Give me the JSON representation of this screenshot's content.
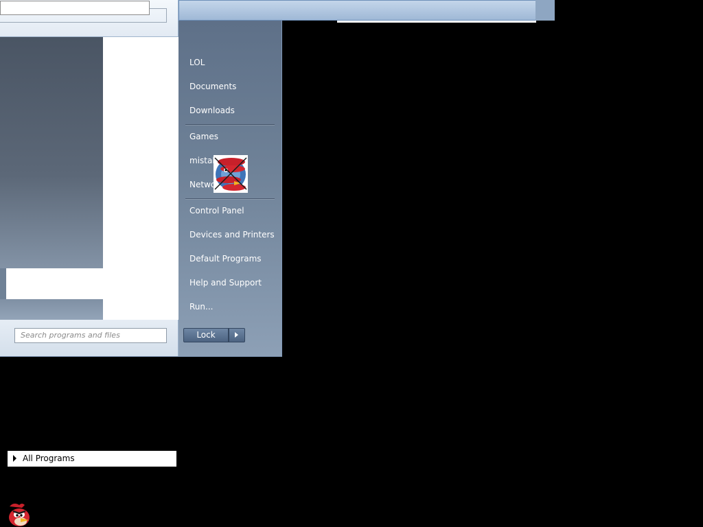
{
  "search": {
    "placeholder": "Search programs and files"
  },
  "right_menu": {
    "items": [
      {
        "label": "LOL"
      },
      {
        "label": "Documents"
      },
      {
        "label": "Downloads"
      },
      {
        "label": "Games"
      },
      {
        "label": "mistak"
      },
      {
        "label": "Netwo"
      },
      {
        "label": "Control Panel"
      },
      {
        "label": "Devices and Printers"
      },
      {
        "label": "Default Programs"
      },
      {
        "label": "Help and Support"
      },
      {
        "label": "Run..."
      }
    ]
  },
  "shutdown": {
    "label": "Lock"
  },
  "all_programs": {
    "label": "All Programs"
  },
  "icons": {
    "overlay": "angry-bird-icon",
    "start": "angry-bird-icon",
    "arrow": "triangle-right-icon"
  },
  "colors": {
    "right_pane": "#6f8298",
    "frame": "#b9cbe0",
    "background": "#000000"
  }
}
